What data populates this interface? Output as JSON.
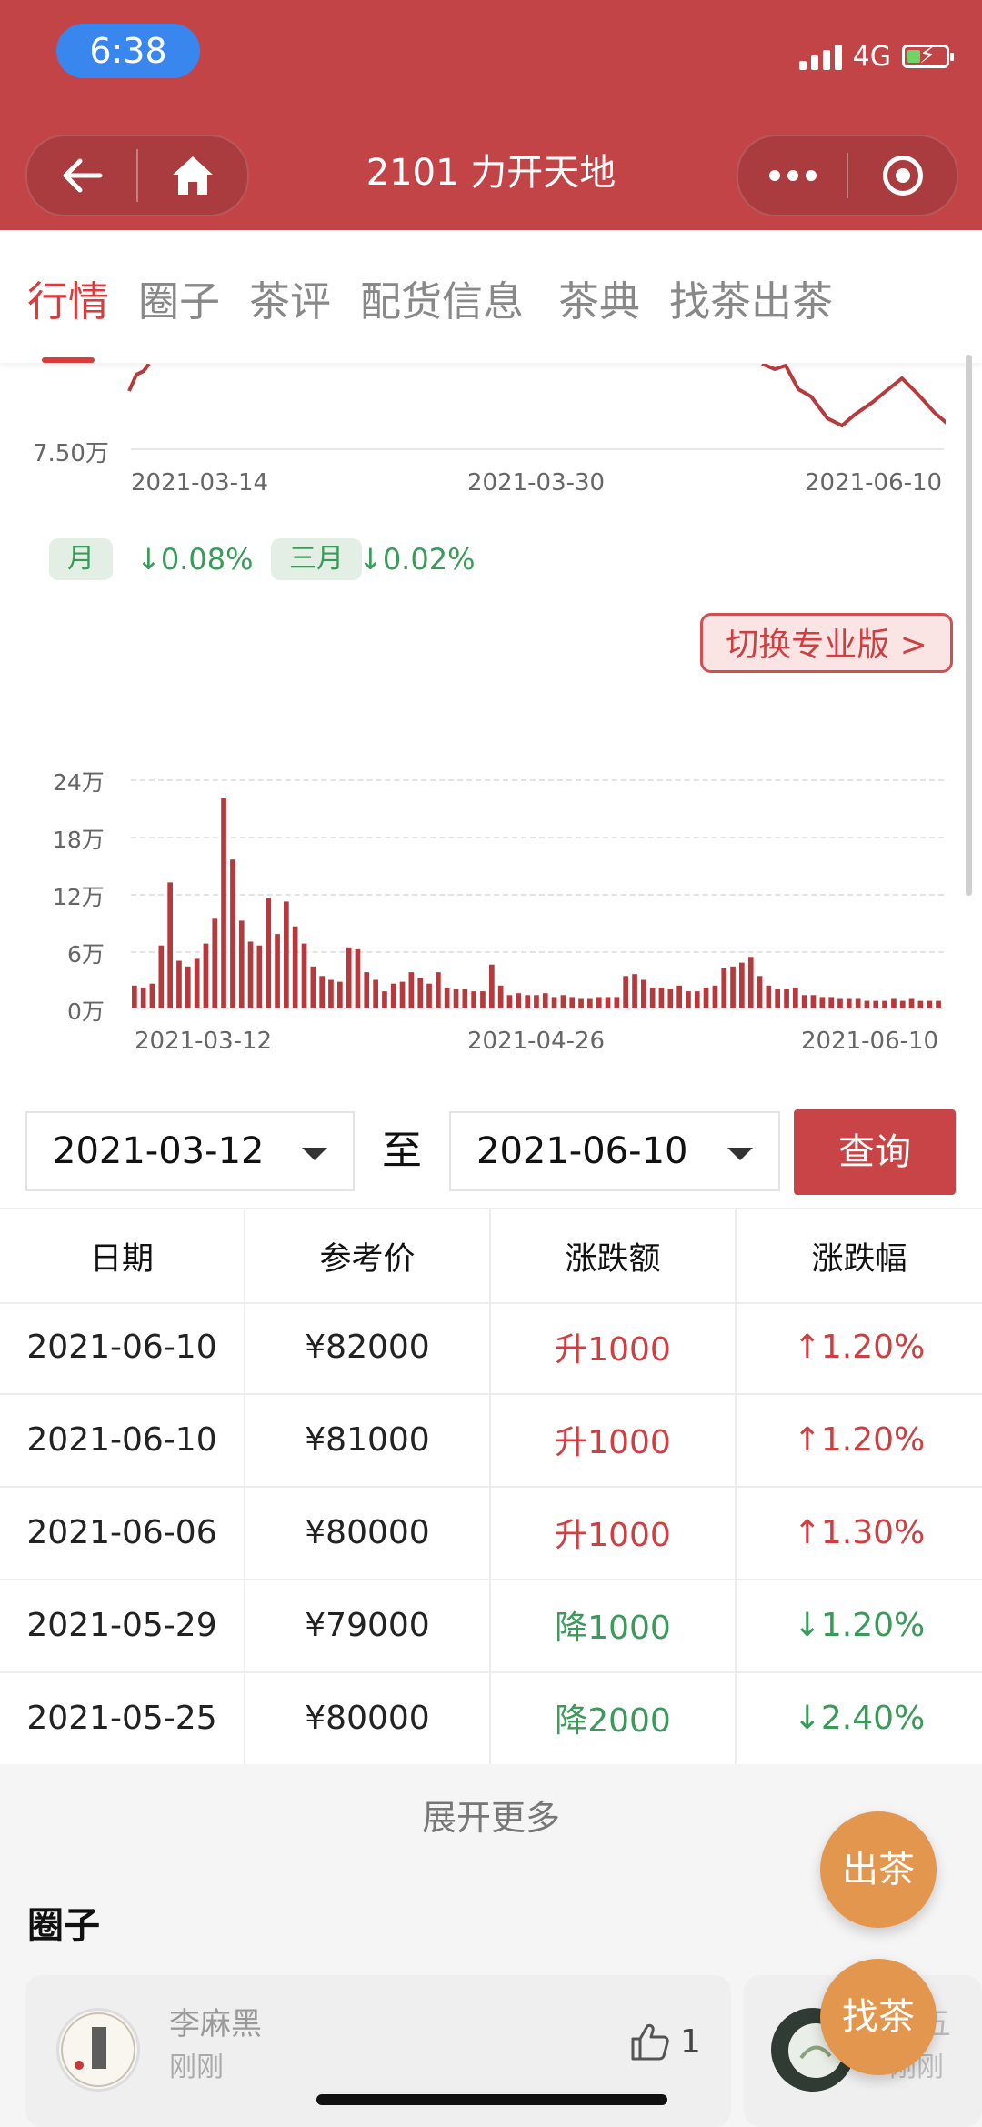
{
  "status": {
    "time": "6:38",
    "network": "4G"
  },
  "header": {
    "title": "2101 力开天地"
  },
  "tabs": [
    "行情",
    "圈子",
    "茶评",
    "配货信息",
    "茶典",
    "找茶出茶"
  ],
  "line_chart": {
    "ytick": "7.50万",
    "xticks": [
      "2021-03-14",
      "2021-03-30",
      "2021-06-10"
    ]
  },
  "changes": [
    {
      "label": "月",
      "value": "↓0.08%"
    },
    {
      "label": "三月",
      "value": "↓0.02%"
    }
  ],
  "pro_button": "切换专业版 >",
  "chart_data": {
    "type": "bar",
    "yticks": [
      "24万",
      "18万",
      "12万",
      "6万",
      "0万"
    ],
    "xticks": [
      "2021-03-12",
      "2021-04-26",
      "2021-06-10"
    ],
    "ylim": [
      0,
      24
    ],
    "ylabel_unit": "万",
    "values": [
      2.4,
      2.2,
      2.6,
      6.6,
      13.2,
      5.0,
      4.4,
      5.2,
      6.8,
      9.4,
      22.0,
      15.6,
      9.2,
      7.0,
      6.6,
      11.6,
      7.8,
      11.2,
      8.6,
      6.8,
      4.4,
      3.4,
      3.0,
      2.8,
      6.4,
      6.2,
      3.8,
      3.0,
      1.8,
      2.6,
      2.8,
      3.8,
      3.2,
      2.6,
      3.8,
      2.2,
      2.0,
      2.0,
      1.8,
      1.8,
      4.6,
      2.4,
      1.4,
      1.6,
      1.4,
      1.4,
      1.6,
      1.2,
      1.4,
      1.2,
      1.0,
      1.0,
      1.2,
      1.2,
      1.2,
      3.4,
      3.6,
      3.0,
      2.2,
      2.2,
      2.0,
      2.4,
      1.8,
      1.8,
      2.2,
      2.4,
      4.2,
      4.4,
      4.8,
      5.4,
      3.4,
      2.4,
      2.0,
      2.0,
      2.2,
      1.4,
      1.4,
      1.2,
      1.2,
      1.0,
      1.0,
      1.0,
      0.8,
      0.8,
      0.8,
      1.0,
      0.8,
      1.0,
      0.8,
      0.8,
      0.8
    ]
  },
  "range": {
    "from": "2021-03-12",
    "to": "2021-06-10",
    "separator": "至",
    "query": "查询"
  },
  "table": {
    "headers": [
      "日期",
      "参考价",
      "涨跌额",
      "涨跌幅"
    ],
    "rows": [
      {
        "date": "2021-06-10",
        "price": "¥82000",
        "change": "升1000",
        "pct": "↑1.20%",
        "dir": "up"
      },
      {
        "date": "2021-06-10",
        "price": "¥81000",
        "change": "升1000",
        "pct": "↑1.20%",
        "dir": "up"
      },
      {
        "date": "2021-06-06",
        "price": "¥80000",
        "change": "升1000",
        "pct": "↑1.30%",
        "dir": "up"
      },
      {
        "date": "2021-05-29",
        "price": "¥79000",
        "change": "降1000",
        "pct": "↓1.20%",
        "dir": "down"
      },
      {
        "date": "2021-05-25",
        "price": "¥80000",
        "change": "降2000",
        "pct": "↓2.40%",
        "dir": "down"
      }
    ]
  },
  "more": "展开更多",
  "circle": {
    "title": "圈子",
    "cards": [
      {
        "name": "李麻黑",
        "time": "刚刚",
        "likes": "1"
      },
      {
        "name": "秋五",
        "time": "刚刚"
      }
    ]
  },
  "fab": {
    "sell": "出茶",
    "find": "找茶"
  }
}
